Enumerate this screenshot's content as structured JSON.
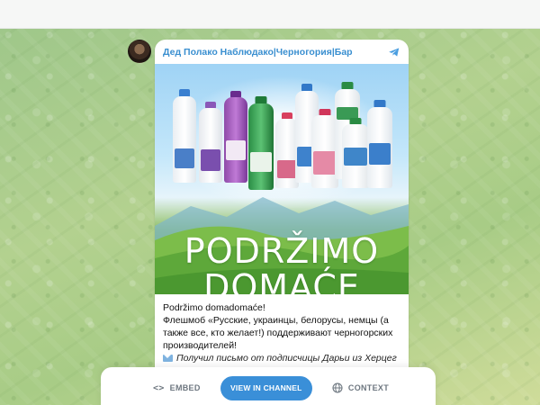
{
  "post": {
    "channel_name": "Дед Полако Наблюдако|Черногория|Бар",
    "image": {
      "headline_line1": "PODRŽIMO",
      "headline_line2": "DOMAĆE",
      "bottle_labels": [
        "Vitto",
        "Vitto",
        "JOGURT"
      ]
    },
    "text": {
      "line1": "Podržimo domadomaće!",
      "line2": "Флешмоб «Русские, украинцы, белорусы, немцы (а также все, кто желает!) поддерживают черногорских производителей!",
      "line3": "Получил письмо от подписчицы Дарьи из Херцег Нови!"
    }
  },
  "actions": {
    "embed_label": "EMBED",
    "view_label": "VIEW IN CHANNEL",
    "context_label": "CONTEXT"
  },
  "colors": {
    "accent": "#3a8fd8",
    "channel_name": "#3a8fd0",
    "chat_background": "#a8cc86"
  },
  "icons": {
    "telegram": "telegram-icon",
    "embed": "code-icon",
    "context": "globe-icon",
    "mail": "envelope-icon"
  }
}
